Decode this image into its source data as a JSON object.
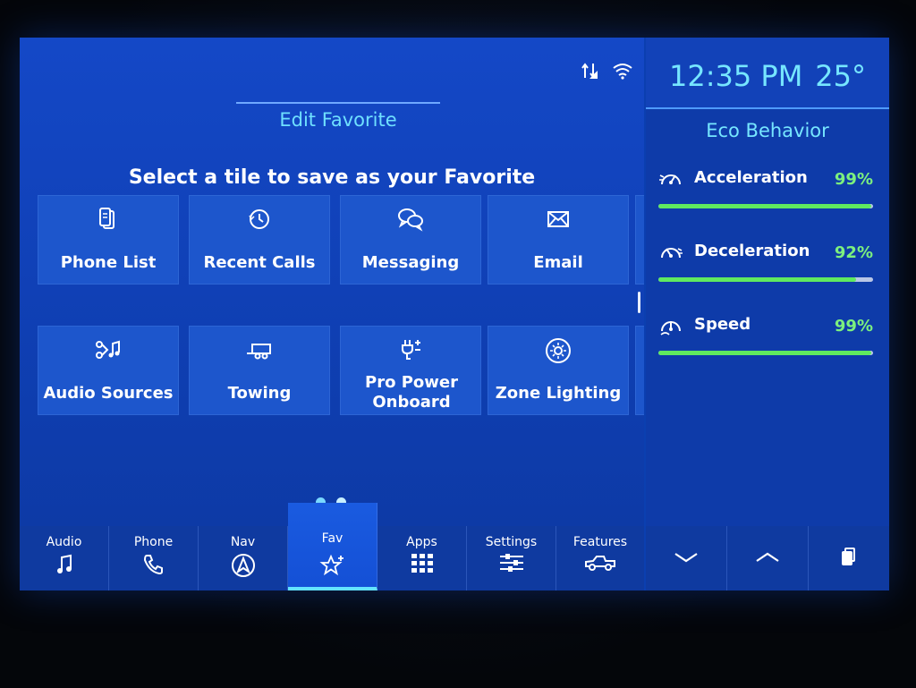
{
  "header": {
    "edit_tab": "Edit Favorite",
    "prompt": "Select a tile to save as your Favorite"
  },
  "tiles": [
    {
      "label": "Phone List",
      "icon": "phone-list-icon"
    },
    {
      "label": "Recent Calls",
      "icon": "recent-calls-icon"
    },
    {
      "label": "Messaging",
      "icon": "messaging-icon"
    },
    {
      "label": "Email",
      "icon": "email-icon"
    },
    {
      "label": "Audio Sources",
      "icon": "audio-sources-icon"
    },
    {
      "label": "Towing",
      "icon": "towing-icon"
    },
    {
      "label": "Pro Power Onboard",
      "icon": "pro-power-icon"
    },
    {
      "label": "Zone Lighting",
      "icon": "zone-lighting-icon"
    }
  ],
  "page_indicator": {
    "pages": 2
  },
  "bottom_nav": [
    {
      "label": "Audio",
      "icon": "music-note-icon"
    },
    {
      "label": "Phone",
      "icon": "phone-handset-icon"
    },
    {
      "label": "Nav",
      "icon": "navigation-arrow-icon"
    },
    {
      "label": "Fav",
      "icon": "star-plus-icon",
      "active": true
    },
    {
      "label": "Apps",
      "icon": "grid-icon"
    },
    {
      "label": "Settings",
      "icon": "sliders-icon"
    },
    {
      "label": "Features",
      "icon": "truck-icon"
    }
  ],
  "side": {
    "time": "12:35 PM",
    "temp": "25°",
    "eco_title": "Eco Behavior",
    "metrics": [
      {
        "name": "Acceleration",
        "value": "99%",
        "fraction": 0.99,
        "icon": "acceleration-gauge-icon"
      },
      {
        "name": "Deceleration",
        "value": "92%",
        "fraction": 0.92,
        "icon": "deceleration-gauge-icon"
      },
      {
        "name": "Speed",
        "value": "99%",
        "fraction": 0.99,
        "icon": "speed-gauge-icon"
      }
    ],
    "buttons": [
      {
        "icon": "chevron-down-icon"
      },
      {
        "icon": "chevron-up-icon"
      },
      {
        "icon": "copy-icon"
      }
    ]
  },
  "colors": {
    "accent": "#76e6ff",
    "good": "#5fea5f",
    "panel": "#1d56cc"
  }
}
